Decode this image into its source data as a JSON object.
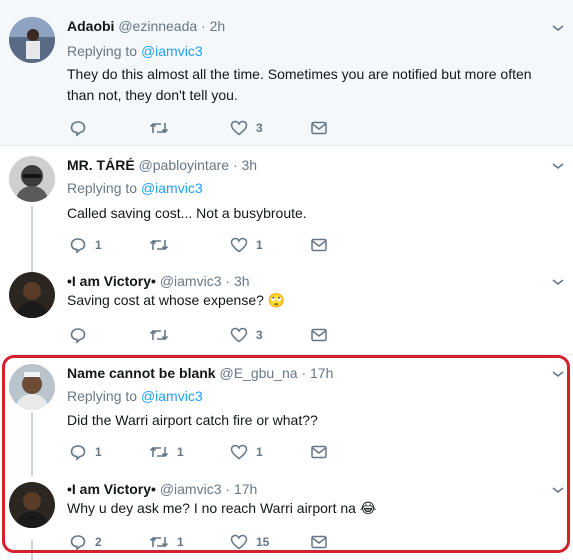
{
  "colors": {
    "accent": "#1da1f2",
    "muted": "#657786",
    "highlight": "#d5202d"
  },
  "replying_label": "Replying to",
  "tweets": [
    {
      "name": "Adaobi",
      "handle": "@ezinneada",
      "dot": "·",
      "time": "2h",
      "mention": "@iamvic3",
      "text": "They do this almost all the time. Sometimes you are notified but more often than not, they don't tell you.",
      "reply_count": "",
      "retweet_count": "",
      "like_count": "3"
    },
    {
      "name": "MR. TÁRÉ",
      "handle": "@pabloyintare",
      "dot": "·",
      "time": "3h",
      "mention": "@iamvic3",
      "text": "Called saving cost... Not a busybroute.",
      "reply_count": "1",
      "retweet_count": "",
      "like_count": "1"
    },
    {
      "name": "•I am Victory•",
      "handle": "@iamvic3",
      "dot": "·",
      "time": "3h",
      "text": "Saving cost at whose expense?",
      "emoji": "🙄",
      "reply_count": "",
      "retweet_count": "",
      "like_count": "3"
    },
    {
      "name": "Name cannot be blank",
      "handle": "@E_gbu_na",
      "dot": "·",
      "time": "17h",
      "mention": "@iamvic3",
      "text": "Did the Warri airport catch fire or what??",
      "reply_count": "1",
      "retweet_count": "1",
      "like_count": "1"
    },
    {
      "name": "•I am Victory•",
      "handle": "@iamvic3",
      "dot": "·",
      "time": "17h",
      "text": "Why u dey ask me? I no reach Warri airport na",
      "emoji": "😂",
      "reply_count": "2",
      "retweet_count": "1",
      "like_count": "15"
    }
  ]
}
